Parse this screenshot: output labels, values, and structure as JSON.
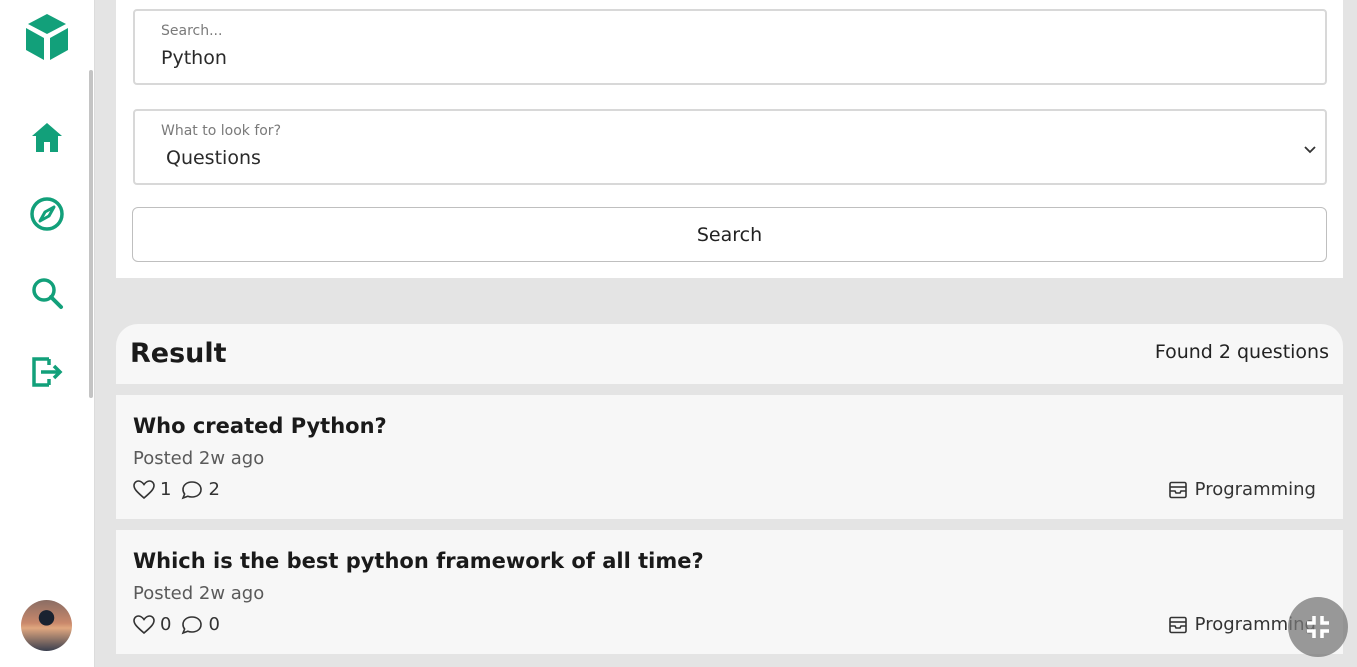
{
  "colors": {
    "accent": "#12a07a",
    "panel": "#ffffff",
    "background": "#e4e4e4"
  },
  "sidebar": {
    "logo": "cube-logo-icon",
    "items": [
      {
        "name": "home",
        "icon": "home-icon"
      },
      {
        "name": "explore",
        "icon": "compass-icon"
      },
      {
        "name": "search",
        "icon": "search-icon"
      },
      {
        "name": "logout",
        "icon": "logout-icon"
      }
    ],
    "avatar": "user-avatar"
  },
  "search": {
    "label": "Search...",
    "value": "Python"
  },
  "filter": {
    "label": "What to look for?",
    "selected": "Questions",
    "icon": "chevron-down-icon"
  },
  "search_button": {
    "label": "Search"
  },
  "results": {
    "title": "Result",
    "count_text": "Found 2 questions",
    "items": [
      {
        "title": "Who created Python?",
        "posted": "Posted 2w ago",
        "likes": "1",
        "comments": "2",
        "category": "Programming"
      },
      {
        "title": "Which is the best python framework of all time?",
        "posted": "Posted 2w ago",
        "likes": "0",
        "comments": "0",
        "category": "Programming"
      }
    ]
  },
  "fab": {
    "icon": "collapse-icon"
  }
}
